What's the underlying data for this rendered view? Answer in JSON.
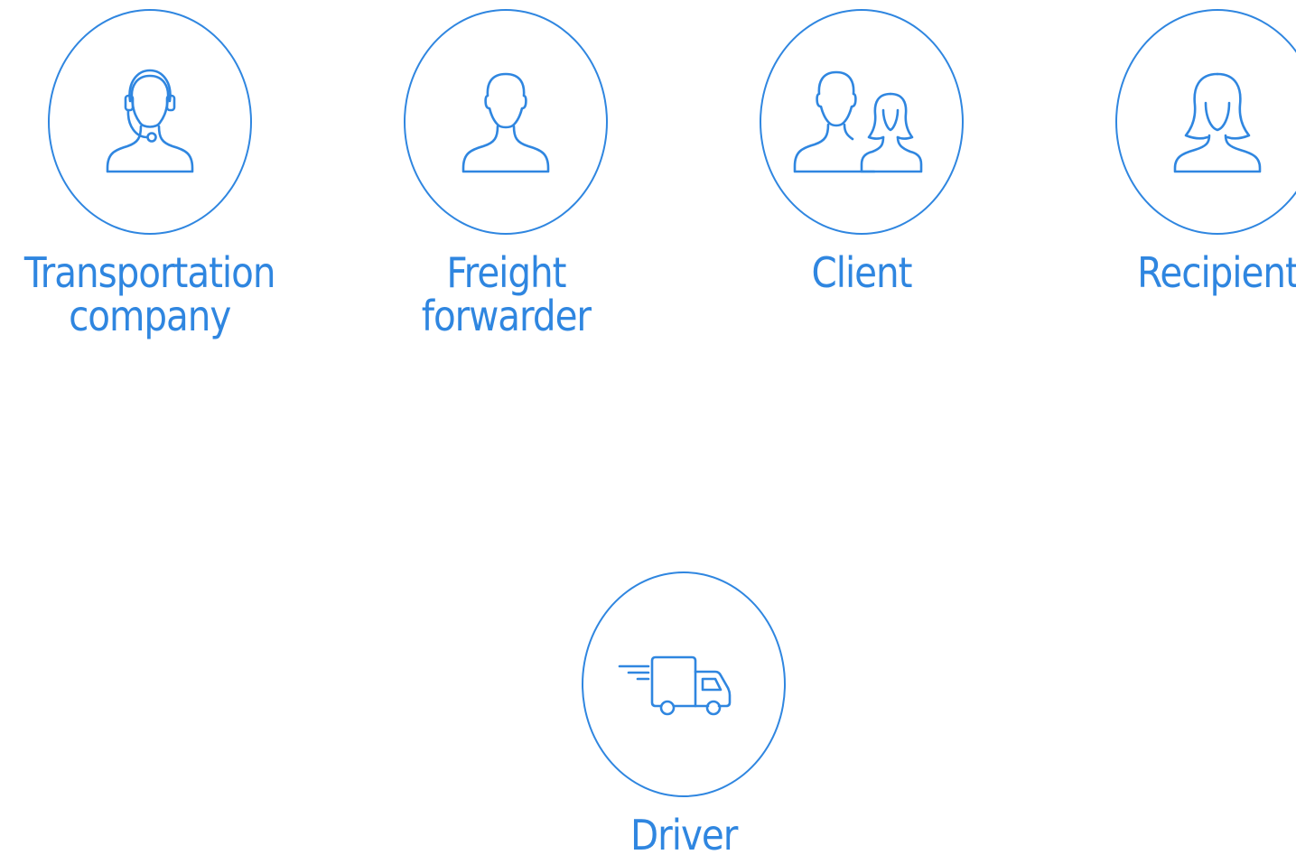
{
  "accent_color": "#2f86e0",
  "roles": [
    {
      "id": "transportation-company",
      "icon": "headset-person-icon",
      "label_lines": [
        "Transportation",
        "company"
      ]
    },
    {
      "id": "freight-forwarder",
      "icon": "male-person-icon",
      "label_lines": [
        "Freight",
        "forwarder"
      ]
    },
    {
      "id": "client",
      "icon": "two-people-icon",
      "label_lines": [
        "Client"
      ]
    },
    {
      "id": "recipient",
      "icon": "female-person-icon",
      "label_lines": [
        "Recipient"
      ]
    },
    {
      "id": "driver",
      "icon": "delivery-truck-icon",
      "label_lines": [
        "Driver"
      ]
    }
  ]
}
